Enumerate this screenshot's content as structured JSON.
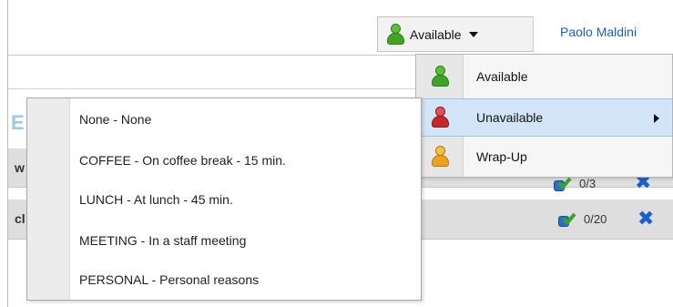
{
  "header": {
    "status_label": "Available",
    "user_name": "Paolo Maldini"
  },
  "status_menu": {
    "items": [
      {
        "label": "Available",
        "icon": "person-green-icon"
      },
      {
        "label": "Unavailable",
        "icon": "person-red-icon",
        "has_submenu": true
      },
      {
        "label": "Wrap-Up",
        "icon": "person-orange-icon"
      }
    ]
  },
  "reasons_menu": {
    "items": [
      "None - None",
      "COFFEE - On coffee break - 15 min.",
      "LUNCH - At lunch - 45 min.",
      "MEETING - In a staff meeting",
      "PERSONAL - Personal reasons"
    ]
  },
  "rows": [
    {
      "prefix": "w",
      "count": "0/3"
    },
    {
      "prefix": "cl",
      "count": "0/20"
    }
  ],
  "background_text": {
    "partial_heading": "E"
  },
  "colors": {
    "link": "#1a5fbf",
    "menu_highlight": "#d2e4f7",
    "remove_x": "#1b5fcf"
  }
}
